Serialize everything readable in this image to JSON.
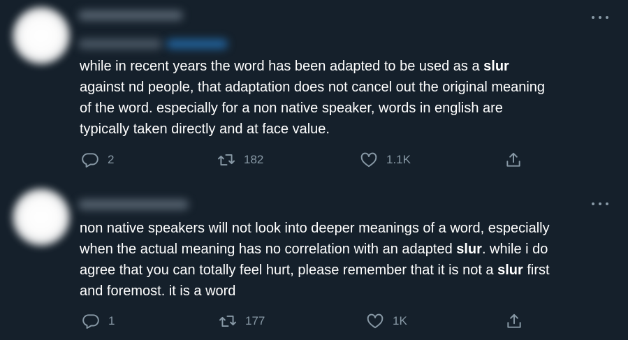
{
  "tweets": [
    {
      "text_parts": [
        "while in recent years the word has been adapted to be used as a ",
        "slur",
        "\nagainst nd people, that adaptation does not cancel out the original meaning\nof the word. especially for a non native speaker, words in english are\ntypically taken directly and at face value."
      ],
      "replies": "2",
      "retweets": "182",
      "likes": "1.1K"
    },
    {
      "text_parts": [
        "non native speakers will not look into deeper meanings of a word, especially\nwhen the actual meaning has no correlation with an adapted ",
        "slur",
        ". while i do\nagree that you can totally feel hurt, please remember that it is not a ",
        "slur",
        " first\nand foremost. it is a word"
      ],
      "replies": "1",
      "retweets": "177",
      "likes": "1K"
    }
  ],
  "colors": {
    "background": "#15202b",
    "text": "#ffffff",
    "secondary": "#8899a6",
    "accent": "#1da1f2"
  },
  "icons": {
    "more": "more-horizontal-icon",
    "reply": "reply-icon",
    "retweet": "retweet-icon",
    "like": "heart-icon",
    "share": "share-icon"
  }
}
